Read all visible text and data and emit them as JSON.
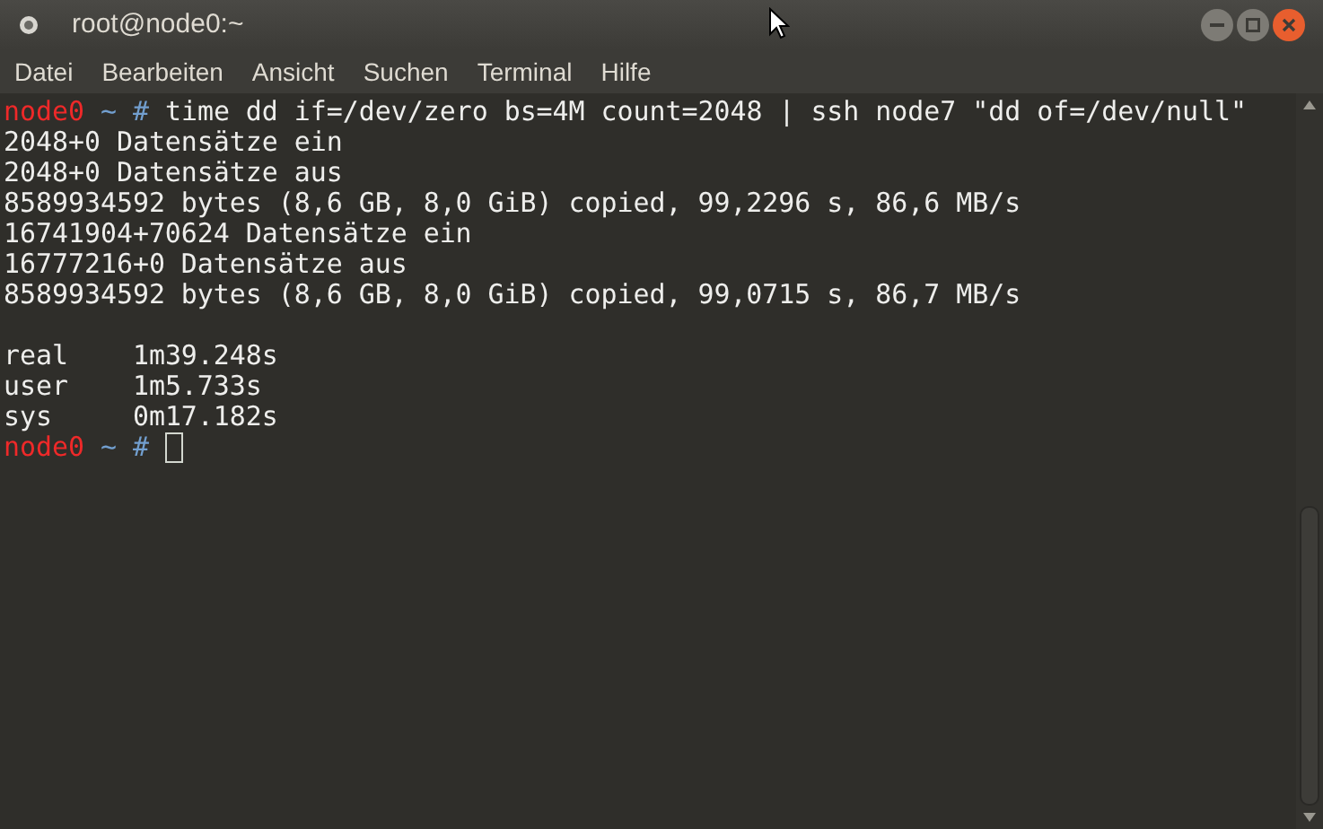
{
  "window": {
    "title": "root@node0:~"
  },
  "menu": [
    "Datei",
    "Bearbeiten",
    "Ansicht",
    "Suchen",
    "Terminal",
    "Hilfe"
  ],
  "terminal": {
    "lines": [
      {
        "kind": "prompt",
        "host": "node0",
        "path": "~",
        "symbol": "#",
        "command": "time dd if=/dev/zero bs=4M count=2048 | ssh node7 \"dd of=/dev/null\"",
        "cursor": false
      },
      {
        "kind": "output",
        "text": "2048+0 Datensätze ein"
      },
      {
        "kind": "output",
        "text": "2048+0 Datensätze aus"
      },
      {
        "kind": "output",
        "text": "8589934592 bytes (8,6 GB, 8,0 GiB) copied, 99,2296 s, 86,6 MB/s"
      },
      {
        "kind": "output",
        "text": "16741904+70624 Datensätze ein"
      },
      {
        "kind": "output",
        "text": "16777216+0 Datensätze aus"
      },
      {
        "kind": "output",
        "text": "8589934592 bytes (8,6 GB, 8,0 GiB) copied, 99,0715 s, 86,7 MB/s"
      },
      {
        "kind": "blank"
      },
      {
        "kind": "output",
        "text": "real\t1m39.248s"
      },
      {
        "kind": "output",
        "text": "user\t1m5.733s"
      },
      {
        "kind": "output",
        "text": "sys\t0m17.182s"
      },
      {
        "kind": "prompt",
        "host": "node0",
        "path": "~",
        "symbol": "#",
        "cursor": true
      }
    ]
  }
}
